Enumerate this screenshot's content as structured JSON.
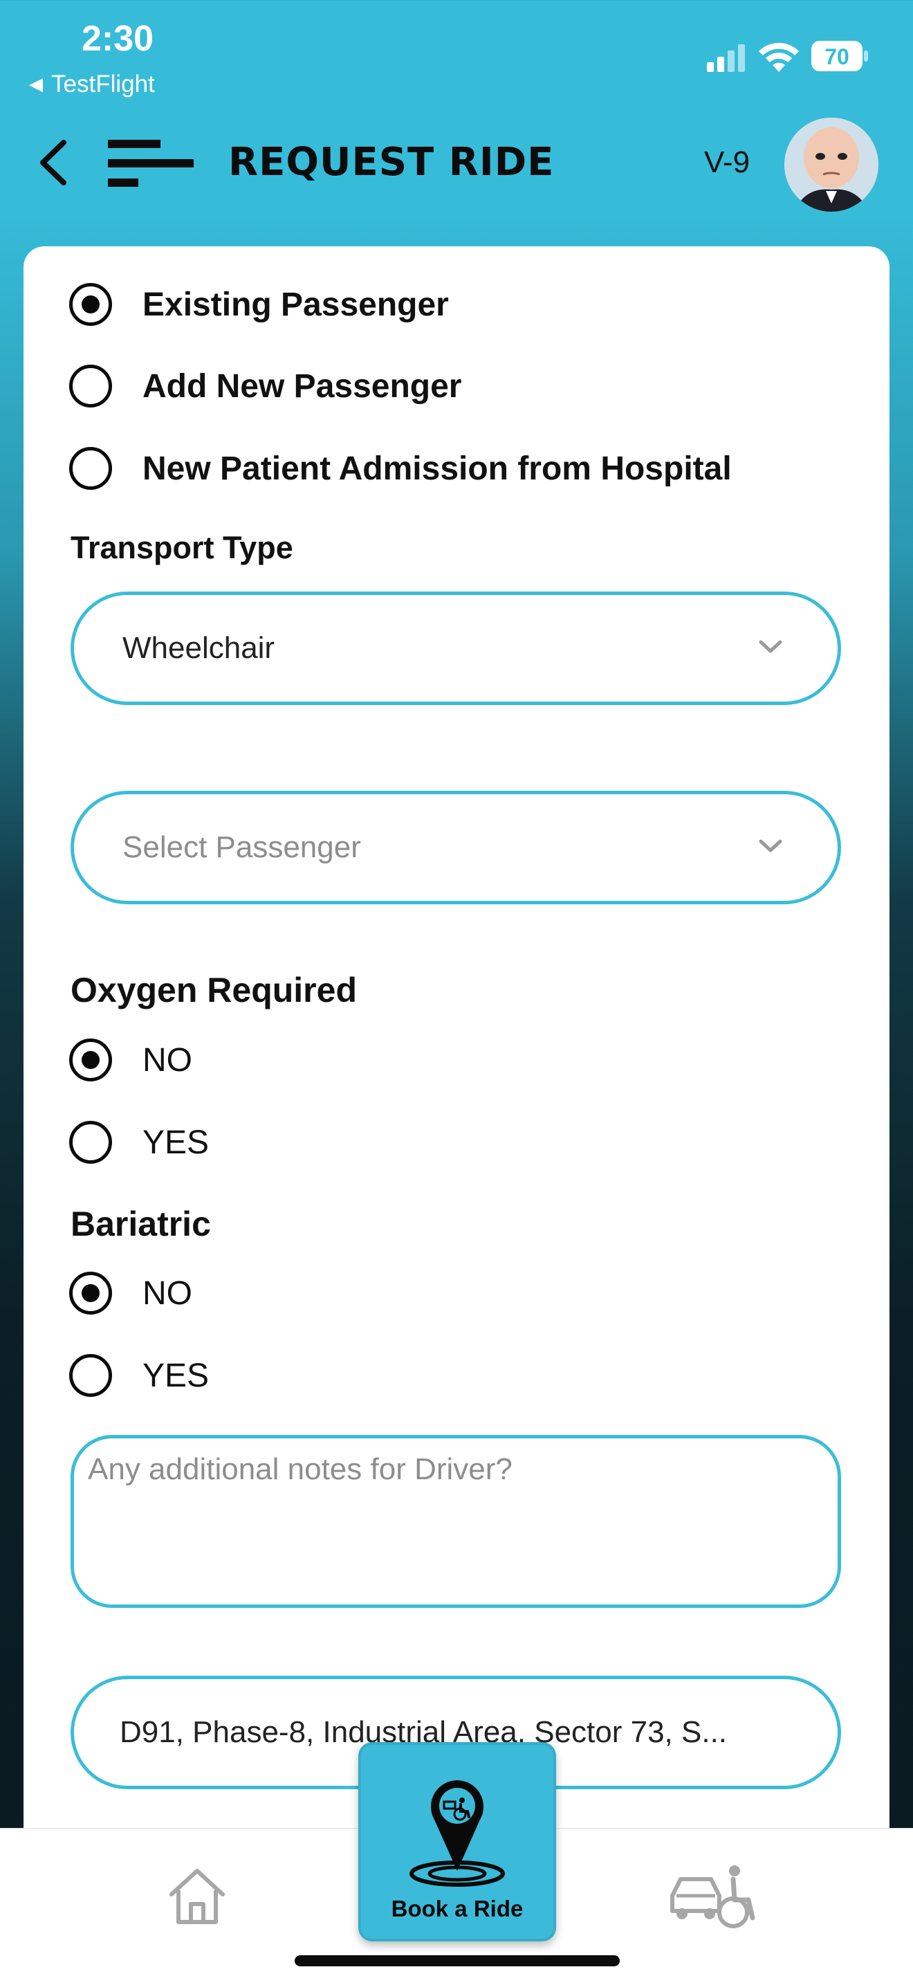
{
  "status_bar": {
    "time": "2:30",
    "back_app": "TestFlight",
    "battery": "70"
  },
  "header": {
    "title": "REQUEST RIDE",
    "version": "V-9"
  },
  "passenger_options": [
    {
      "label": "Existing Passenger",
      "selected": true
    },
    {
      "label": "Add New Passenger",
      "selected": false
    },
    {
      "label": "New Patient Admission from Hospital",
      "selected": false
    }
  ],
  "transport": {
    "label": "Transport Type",
    "value": "Wheelchair"
  },
  "passenger_select": {
    "placeholder": "Select Passenger"
  },
  "oxygen": {
    "label": "Oxygen Required",
    "options": [
      {
        "label": "NO",
        "selected": true
      },
      {
        "label": "YES",
        "selected": false
      }
    ]
  },
  "bariatric": {
    "label": "Bariatric",
    "options": [
      {
        "label": "NO",
        "selected": true
      },
      {
        "label": "YES",
        "selected": false
      }
    ]
  },
  "notes": {
    "placeholder": "Any additional notes for Driver?"
  },
  "address": {
    "value": "D91, Phase-8, Industrial Area, Sector 73, S..."
  },
  "nav": {
    "book_label": "Book a Ride"
  },
  "colors": {
    "accent": "#36bcd9",
    "text": "#111111"
  }
}
